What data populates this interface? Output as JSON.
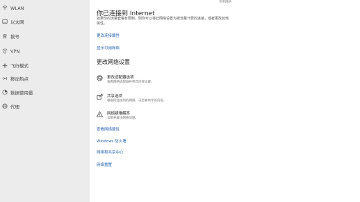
{
  "window": {
    "title": "专用网络"
  },
  "sidebar": {
    "items": [
      {
        "label": "WLAN",
        "icon": "wifi-icon"
      },
      {
        "label": "以太网",
        "icon": "ethernet-icon"
      },
      {
        "label": "拨号",
        "icon": "dialup-icon"
      },
      {
        "label": "VPN",
        "icon": "vpn-icon"
      },
      {
        "label": "飞行模式",
        "icon": "airplane-icon"
      },
      {
        "label": "移动热点",
        "icon": "hotspot-icon"
      },
      {
        "label": "数据使用量",
        "icon": "data-usage-icon"
      },
      {
        "label": "代理",
        "icon": "globe-icon"
      }
    ]
  },
  "status": {
    "title": "你已连接到 Internet",
    "description": "如果你的流量套餐有限制，则你可以将此网络设置为按流量计费的连接，或者更改其他属性。"
  },
  "links": {
    "change_connection_properties": "更改连接属性",
    "show_available_networks": "显示可用网络",
    "view_network_properties": "查看网络属性",
    "windows_firewall": "Windows 防火墙",
    "network_sharing_center": "网络和共享中心",
    "network_reset": "网络重置"
  },
  "change_settings": {
    "title": "更改网络设置",
    "items": [
      {
        "title": "更改适配器选项",
        "description": "查看网络适配器并更改连接设置。",
        "icon": "adapter-icon"
      },
      {
        "title": "共享选项",
        "description": "根据所连接到的网络，决定要共享的内容。",
        "icon": "sharing-icon"
      },
      {
        "title": "网络疑难解答",
        "description": "诊断并解决网络问题。",
        "icon": "warning-icon"
      }
    ]
  },
  "colors": {
    "sidebar_bg": "#ececec",
    "link": "#2462b0",
    "content_bg": "#ffffff"
  }
}
